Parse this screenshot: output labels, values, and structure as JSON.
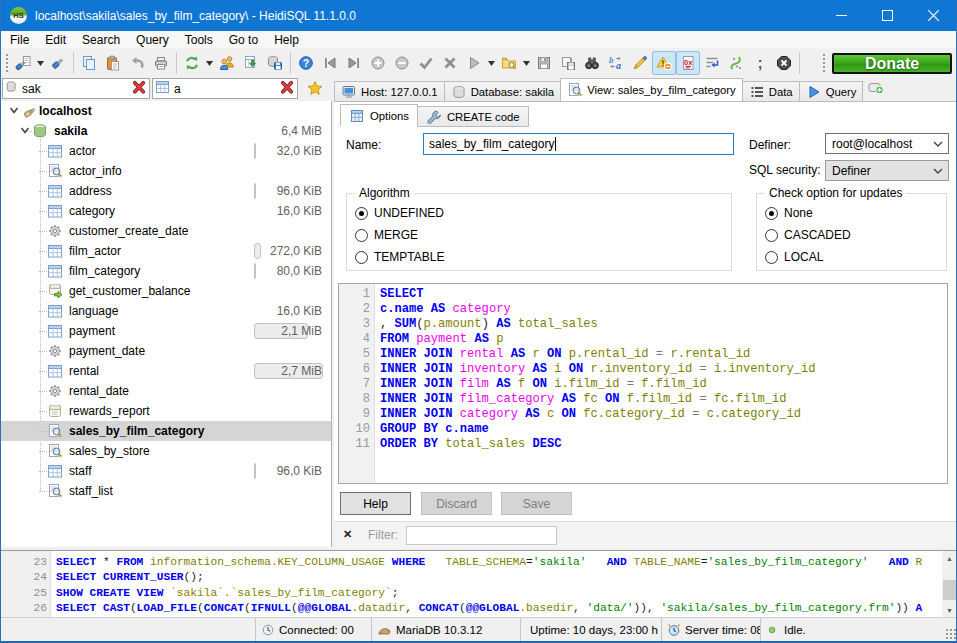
{
  "window": {
    "title": "localhost\\sakila\\sales_by_film_category\\ - HeidiSQL 11.1.0.0",
    "app_icon_text": "HS",
    "controls": [
      "minimize",
      "maximize",
      "close"
    ]
  },
  "menu": {
    "items": [
      "File",
      "Edit",
      "Search",
      "Query",
      "Tools",
      "Go to",
      "Help"
    ]
  },
  "toolbar": {
    "buttons": [
      {
        "type": "grip"
      },
      {
        "type": "icon",
        "name": "session-manager-icon",
        "icon": "sessionmgr"
      },
      {
        "type": "dd",
        "name": "session-dropdown"
      },
      {
        "type": "icon",
        "name": "disconnect-icon",
        "icon": "plug"
      },
      {
        "type": "sep"
      },
      {
        "type": "icon",
        "name": "copy-icon",
        "icon": "copy"
      },
      {
        "type": "icon",
        "name": "paste-icon",
        "icon": "paste"
      },
      {
        "type": "icon",
        "name": "undo-icon",
        "icon": "undo"
      },
      {
        "type": "icon",
        "name": "print-icon",
        "icon": "print"
      },
      {
        "type": "sep"
      },
      {
        "type": "icon",
        "name": "refresh-icon",
        "icon": "refresh"
      },
      {
        "type": "dd",
        "name": "refresh-dropdown"
      },
      {
        "type": "icon",
        "name": "user-manager-icon",
        "icon": "users"
      },
      {
        "type": "icon",
        "name": "import-icon",
        "icon": "import"
      },
      {
        "type": "icon",
        "name": "export-database-icon",
        "icon": "exportdb"
      },
      {
        "type": "sep"
      },
      {
        "type": "icon",
        "name": "help-icon",
        "icon": "help"
      },
      {
        "type": "icon",
        "name": "first-record-icon",
        "icon": "navfirst"
      },
      {
        "type": "icon",
        "name": "last-record-icon",
        "icon": "navlast"
      },
      {
        "type": "icon",
        "name": "insert-record-icon",
        "icon": "addcircle"
      },
      {
        "type": "icon",
        "name": "delete-record-icon",
        "icon": "remcircle"
      },
      {
        "type": "icon",
        "name": "post-icon",
        "icon": "check"
      },
      {
        "type": "icon",
        "name": "cancel-editing-icon",
        "icon": "cross"
      },
      {
        "type": "icon",
        "name": "execute-sql-icon",
        "icon": "playgray"
      },
      {
        "type": "dd",
        "name": "execute-dropdown"
      },
      {
        "type": "icon",
        "name": "load-sql-icon",
        "icon": "folderfind"
      },
      {
        "type": "dd",
        "name": "load-dropdown"
      },
      {
        "type": "icon",
        "name": "save-sql-icon",
        "icon": "save"
      },
      {
        "type": "icon",
        "name": "save-snippet-icon",
        "icon": "savescroll"
      },
      {
        "type": "icon",
        "name": "find-text-icon",
        "icon": "binoculars"
      },
      {
        "type": "icon",
        "name": "replace-text-icon",
        "icon": "replaceab"
      },
      {
        "type": "icon",
        "name": "beautify-sql-icon",
        "icon": "pen"
      },
      {
        "type": "icon",
        "name": "stop-on-errors-icon",
        "icon": "warnbadge",
        "toggled": true
      },
      {
        "type": "icon",
        "name": "binary-as-hex-icon",
        "icon": "hexdoc",
        "toggled": true
      },
      {
        "type": "icon",
        "name": "word-wrap-icon",
        "icon": "wrap"
      },
      {
        "type": "icon",
        "name": "reformat-icon",
        "icon": "reformat"
      },
      {
        "type": "icon",
        "name": "delimiter-icon",
        "icon": "semicolon"
      },
      {
        "type": "icon",
        "name": "stop-icon",
        "icon": "stopoct"
      },
      {
        "type": "sep"
      }
    ],
    "donate_label": "Donate"
  },
  "sidebar": {
    "filter1": {
      "value": "sak",
      "icon": "dbsmall"
    },
    "filter2": {
      "value": "a",
      "icon": "tablesmall"
    },
    "tree": [
      {
        "label": "localhost",
        "level": 0,
        "icon": "host",
        "bold": true,
        "expanded": true
      },
      {
        "label": "sakila",
        "level": 1,
        "icon": "dbgreen",
        "bold": true,
        "expanded": true,
        "size": "6,4 MiB"
      },
      {
        "label": "actor",
        "level": 2,
        "icon": "table",
        "size": "32,0 KiB",
        "bar_kib": 32
      },
      {
        "label": "actor_info",
        "level": 2,
        "icon": "view"
      },
      {
        "label": "address",
        "level": 2,
        "icon": "table",
        "size": "96,0 KiB",
        "bar_kib": 96
      },
      {
        "label": "category",
        "level": 2,
        "icon": "table",
        "size": "16,0 KiB"
      },
      {
        "label": "customer_create_date",
        "level": 2,
        "icon": "gear"
      },
      {
        "label": "film_actor",
        "level": 2,
        "icon": "table",
        "size": "272,0 KiB",
        "bar_kib": 272
      },
      {
        "label": "film_category",
        "level": 2,
        "icon": "table",
        "size": "80,0 KiB",
        "bar_kib": 80
      },
      {
        "label": "get_customer_balance",
        "level": 2,
        "icon": "scrollfx"
      },
      {
        "label": "language",
        "level": 2,
        "icon": "table",
        "size": "16,0 KiB"
      },
      {
        "label": "payment",
        "level": 2,
        "icon": "table",
        "size": "2,1 MiB",
        "bar_kib": 2150
      },
      {
        "label": "payment_date",
        "level": 2,
        "icon": "gear"
      },
      {
        "label": "rental",
        "level": 2,
        "icon": "table",
        "size": "2,7 MiB",
        "bar_kib": 2765
      },
      {
        "label": "rental_date",
        "level": 2,
        "icon": "gear"
      },
      {
        "label": "rewards_report",
        "level": 2,
        "icon": "scroll"
      },
      {
        "label": "sales_by_film_category",
        "level": 2,
        "icon": "view",
        "bold": true,
        "selected": true
      },
      {
        "label": "sales_by_store",
        "level": 2,
        "icon": "view"
      },
      {
        "label": "staff",
        "level": 2,
        "icon": "table",
        "size": "96,0 KiB",
        "bar_kib": 96
      },
      {
        "label": "staff_list",
        "level": 2,
        "icon": "view"
      }
    ]
  },
  "tabs": {
    "main": [
      {
        "label": "Host: 127.0.0.1",
        "icon": "monitor"
      },
      {
        "label": "Database: sakila",
        "icon": "dbgray"
      },
      {
        "label": "View: sales_by_film_category",
        "icon": "view",
        "active": true
      },
      {
        "label": "Data",
        "icon": "rows"
      },
      {
        "label": "Query",
        "icon": "playblue"
      }
    ],
    "sub": [
      {
        "label": "Options",
        "icon": "gridblue",
        "active": true
      },
      {
        "label": "CREATE code",
        "icon": "wrench"
      }
    ]
  },
  "form": {
    "name_label": "Name:",
    "name_value": "sales_by_film_category",
    "definer_label": "Definer:",
    "definer_value": "root@localhost",
    "sql_security_label": "SQL security:",
    "sql_security_value": "Definer"
  },
  "algorithm": {
    "legend": "Algorithm",
    "options": [
      {
        "label": "UNDEFINED",
        "checked": true
      },
      {
        "label": "MERGE",
        "checked": false
      },
      {
        "label": "TEMPTABLE",
        "checked": false
      }
    ]
  },
  "check_option": {
    "legend": "Check option for updates",
    "options": [
      {
        "label": "None",
        "checked": true
      },
      {
        "label": "CASCADED",
        "checked": false
      },
      {
        "label": "LOCAL",
        "checked": false
      }
    ]
  },
  "editor": {
    "lines": [
      {
        "num": "1",
        "tokens": [
          [
            "k",
            "SELECT"
          ]
        ]
      },
      {
        "num": "2",
        "tokens": [
          [
            "k",
            "c.name"
          ],
          [
            "p",
            " "
          ],
          [
            "k",
            "AS"
          ],
          [
            "p",
            " "
          ],
          [
            "t",
            "category"
          ]
        ]
      },
      {
        "num": "3",
        "tokens": [
          [
            "p",
            ", "
          ],
          [
            "k",
            "SUM"
          ],
          [
            "p",
            "("
          ],
          [
            "i",
            "p.amount"
          ],
          [
            "p",
            ") "
          ],
          [
            "k",
            "AS"
          ],
          [
            "p",
            " "
          ],
          [
            "i",
            "total_sales"
          ]
        ]
      },
      {
        "num": "4",
        "tokens": [
          [
            "k",
            "FROM"
          ],
          [
            "p",
            " "
          ],
          [
            "t",
            "payment"
          ],
          [
            "p",
            " "
          ],
          [
            "k",
            "AS"
          ],
          [
            "p",
            " "
          ],
          [
            "i",
            "p"
          ]
        ]
      },
      {
        "num": "5",
        "tokens": [
          [
            "k",
            "INNER JOIN"
          ],
          [
            "p",
            " "
          ],
          [
            "t",
            "rental"
          ],
          [
            "p",
            " "
          ],
          [
            "k",
            "AS"
          ],
          [
            "p",
            " "
          ],
          [
            "i",
            "r"
          ],
          [
            "p",
            " "
          ],
          [
            "k",
            "ON"
          ],
          [
            "p",
            " "
          ],
          [
            "i",
            "p.rental_id"
          ],
          [
            "g",
            " = "
          ],
          [
            "i",
            "r.rental_id"
          ]
        ]
      },
      {
        "num": "6",
        "tokens": [
          [
            "k",
            "INNER JOIN"
          ],
          [
            "p",
            " "
          ],
          [
            "t",
            "inventory"
          ],
          [
            "p",
            " "
          ],
          [
            "k",
            "AS"
          ],
          [
            "p",
            " "
          ],
          [
            "i",
            "i"
          ],
          [
            "p",
            " "
          ],
          [
            "k",
            "ON"
          ],
          [
            "p",
            " "
          ],
          [
            "i",
            "r.inventory_id"
          ],
          [
            "g",
            " = "
          ],
          [
            "i",
            "i.inventory_id"
          ]
        ]
      },
      {
        "num": "7",
        "tokens": [
          [
            "k",
            "INNER JOIN"
          ],
          [
            "p",
            " "
          ],
          [
            "t",
            "film"
          ],
          [
            "p",
            " "
          ],
          [
            "k",
            "AS"
          ],
          [
            "p",
            " "
          ],
          [
            "i",
            "f"
          ],
          [
            "p",
            " "
          ],
          [
            "k",
            "ON"
          ],
          [
            "p",
            " "
          ],
          [
            "i",
            "i.film_id"
          ],
          [
            "g",
            " = "
          ],
          [
            "i",
            "f.film_id"
          ]
        ]
      },
      {
        "num": "8",
        "tokens": [
          [
            "k",
            "INNER JOIN"
          ],
          [
            "p",
            " "
          ],
          [
            "t",
            "film_category"
          ],
          [
            "p",
            " "
          ],
          [
            "k",
            "AS"
          ],
          [
            "p",
            " "
          ],
          [
            "i",
            "fc"
          ],
          [
            "p",
            " "
          ],
          [
            "k",
            "ON"
          ],
          [
            "p",
            " "
          ],
          [
            "i",
            "f.film_id"
          ],
          [
            "g",
            " = "
          ],
          [
            "i",
            "fc.film_id"
          ]
        ]
      },
      {
        "num": "9",
        "tokens": [
          [
            "k",
            "INNER JOIN"
          ],
          [
            "p",
            " "
          ],
          [
            "t",
            "category"
          ],
          [
            "p",
            " "
          ],
          [
            "k",
            "AS"
          ],
          [
            "p",
            " "
          ],
          [
            "i",
            "c"
          ],
          [
            "p",
            " "
          ],
          [
            "k",
            "ON"
          ],
          [
            "p",
            " "
          ],
          [
            "i",
            "fc.category_id"
          ],
          [
            "g",
            " = "
          ],
          [
            "i",
            "c.category_id"
          ]
        ]
      },
      {
        "num": "10",
        "tokens": [
          [
            "k",
            "GROUP BY"
          ],
          [
            "p",
            " "
          ],
          [
            "k",
            "c.name"
          ]
        ]
      },
      {
        "num": "11",
        "tokens": [
          [
            "k",
            "ORDER BY"
          ],
          [
            "p",
            " "
          ],
          [
            "i",
            "total_sales"
          ],
          [
            "p",
            " "
          ],
          [
            "k",
            "DESC"
          ]
        ]
      }
    ]
  },
  "buttons": {
    "help": "Help",
    "discard": "Discard",
    "save": "Save"
  },
  "filter_bar": {
    "label": "Filter:",
    "value": ""
  },
  "log": {
    "lines": [
      {
        "num": "23",
        "tokens": [
          [
            "k",
            "SELECT"
          ],
          [
            "p",
            " * "
          ],
          [
            "k",
            "FROM"
          ],
          [
            "p",
            " "
          ],
          [
            "i",
            "information_schema.KEY_COLUMN_USAGE"
          ],
          [
            "p",
            " "
          ],
          [
            "k",
            "WHERE"
          ],
          [
            "p",
            "   "
          ],
          [
            "i",
            "TABLE_SCHEMA"
          ],
          [
            "p",
            "="
          ],
          [
            "s",
            "'sakila'"
          ],
          [
            "p",
            "   "
          ],
          [
            "k",
            "AND"
          ],
          [
            "p",
            " "
          ],
          [
            "i",
            "TABLE_NAME"
          ],
          [
            "p",
            "="
          ],
          [
            "s",
            "'sales_by_film_category'"
          ],
          [
            "p",
            "   "
          ],
          [
            "k",
            "AND"
          ],
          [
            "p",
            " "
          ],
          [
            "i",
            "R"
          ]
        ]
      },
      {
        "num": "24",
        "tokens": [
          [
            "k",
            "SELECT"
          ],
          [
            "p",
            " "
          ],
          [
            "k",
            "CURRENT_USER"
          ],
          [
            "p",
            "();"
          ]
        ]
      },
      {
        "num": "25",
        "tokens": [
          [
            "k",
            "SHOW CREATE VIEW"
          ],
          [
            "p",
            " "
          ],
          [
            "i",
            "`sakila`.`sales_by_film_category`"
          ],
          [
            "p",
            ";"
          ]
        ]
      },
      {
        "num": "26",
        "tokens": [
          [
            "k",
            "SELECT"
          ],
          [
            "p",
            " "
          ],
          [
            "k",
            "CAST"
          ],
          [
            "p",
            "("
          ],
          [
            "k",
            "LOAD_FILE"
          ],
          [
            "p",
            "("
          ],
          [
            "k",
            "CONCAT"
          ],
          [
            "p",
            "("
          ],
          [
            "k",
            "IFNULL"
          ],
          [
            "p",
            "("
          ],
          [
            "k",
            "@@GLOBAL"
          ],
          [
            "i",
            ".datadir"
          ],
          [
            "p",
            ", "
          ],
          [
            "k",
            "CONCAT"
          ],
          [
            "p",
            "("
          ],
          [
            "k",
            "@@GLOBAL"
          ],
          [
            "i",
            ".basedir"
          ],
          [
            "p",
            ", "
          ],
          [
            "s",
            "'data/'"
          ],
          [
            "p",
            ")), "
          ],
          [
            "s",
            "'sakila/sales_by_film_category.frm'"
          ],
          [
            "p",
            ")) "
          ],
          [
            "k",
            "A"
          ]
        ]
      }
    ]
  },
  "statusbar": {
    "sections": [
      {
        "text": ""
      },
      {
        "icon": "clock",
        "text": "Connected: 00"
      },
      {
        "icon": "seal",
        "text": "MariaDB 10.3.12"
      },
      {
        "text": "Uptime: 10 days, 23:00 h"
      },
      {
        "icon": "alarm",
        "text": "Server time: 08"
      },
      {
        "icon": "greendot",
        "text": "Idle."
      }
    ]
  },
  "colors": {
    "titlebar": "#0f76d3",
    "donate_green": "#3ca81e",
    "keyword": "#0000f0",
    "tablename": "#ee00ee",
    "identifier": "#7f7f00",
    "string": "#008000",
    "selection": "#d5d5d5"
  }
}
